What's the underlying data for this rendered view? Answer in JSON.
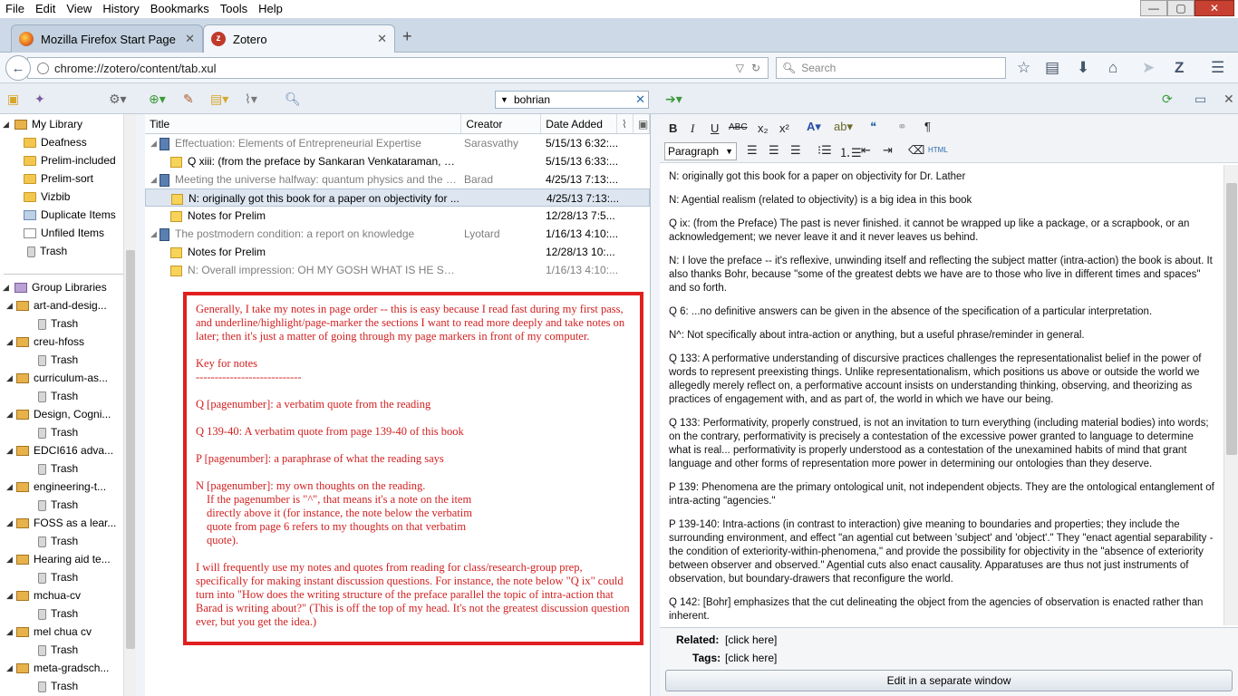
{
  "menubar": {
    "items": [
      "File",
      "Edit",
      "View",
      "History",
      "Bookmarks",
      "Tools",
      "Help"
    ]
  },
  "window": {
    "minimize": "—",
    "maximize": "▢",
    "close": "✕"
  },
  "tabs": [
    {
      "label": "Mozilla Firefox Start Page",
      "close": "✕"
    },
    {
      "label": "Zotero",
      "close": "✕"
    }
  ],
  "new_tab": "+",
  "navbar": {
    "url": "chrome://zotero/content/tab.xul",
    "search_placeholder": "Search"
  },
  "zotero_search": {
    "value": "bohrian"
  },
  "collections": {
    "my_library": "My Library",
    "my_items": [
      "Deafness",
      "Prelim-included",
      "Prelim-sort",
      "Vizbib",
      "Duplicate Items",
      "Unfiled Items",
      "Trash"
    ],
    "group_libraries": "Group Libraries",
    "groups": [
      {
        "name": "art-and-desig...",
        "trash": "Trash"
      },
      {
        "name": "creu-hfoss",
        "trash": "Trash"
      },
      {
        "name": "curriculum-as...",
        "trash": "Trash"
      },
      {
        "name": "Design, Cogni...",
        "trash": "Trash"
      },
      {
        "name": "EDCI616 adva...",
        "trash": "Trash"
      },
      {
        "name": "engineering-t...",
        "trash": "Trash"
      },
      {
        "name": "FOSS as a lear...",
        "trash": "Trash"
      },
      {
        "name": "Hearing aid te...",
        "trash": "Trash"
      },
      {
        "name": "mchua-cv",
        "trash": "Trash"
      },
      {
        "name": "mel chua cv",
        "trash": "Trash"
      },
      {
        "name": "meta-gradsch...",
        "trash": "Trash"
      }
    ]
  },
  "items": {
    "headers": {
      "title": "Title",
      "creator": "Creator",
      "date": "Date Added"
    },
    "rows": [
      {
        "title": "Effectuation: Elements of Entrepreneurial Expertise",
        "creator": "Sarasvathy",
        "date": "5/15/13 6:32:..."
      },
      {
        "title": "Q xiii: (from the preface by Sankaran Venkataraman, For...",
        "creator": "",
        "date": "5/15/13 6:33:..."
      },
      {
        "title": "Meeting the universe halfway: quantum physics and the e...",
        "creator": "Barad",
        "date": "4/25/13 7:13:..."
      },
      {
        "title": "N: originally got this book for a paper on objectivity for ...",
        "creator": "",
        "date": "4/25/13 7:13:..."
      },
      {
        "title": "Notes for Prelim",
        "creator": "",
        "date": "12/28/13 7:5..."
      },
      {
        "title": "The postmodern condition: a report on knowledge",
        "creator": "Lyotard",
        "date": "1/16/13 4:10:..."
      },
      {
        "title": "Notes for Prelim",
        "creator": "",
        "date": "12/28/13 10:..."
      },
      {
        "title": "N: Overall impression: OH MY GOSH WHAT IS HE SAYI...",
        "creator": "",
        "date": "1/16/13 4:10:..."
      }
    ]
  },
  "annotation": {
    "p1": "Generally, I take my notes in page order -- this is easy because I read fast during my first pass, and underline/highlight/page-marker the sections I want to read more deeply and take notes on later; then it's just a matter of going through my page markers in front of my computer.",
    "key_title": "Key for notes",
    "key_rule": "----------------------------",
    "k1": "Q [pagenumber]: a verbatim quote from the reading",
    "k2": "Q 139-40: A verbatim quote from page 139-40 of this book",
    "k3": "P [pagenumber]: a paraphrase of what the reading says",
    "k4": "N [pagenumber]: my own thoughts on the reading.",
    "k4b": "If the pagenumber is \"^\", that means it's a note on the item directly above it (for instance, the note below the verbatim quote from page 6 refers to my thoughts on that verbatim quote).",
    "p_last": "I will frequently use my notes and quotes from reading for class/research-group prep, specifically for making instant discussion questions. For instance, the note below \"Q ix\" could turn into \"How does the writing structure of the preface parallel the topic of intra-action that Barad is writing about?\" (This is off the top of my head. It's not the greatest discussion question ever, but you get the idea.)"
  },
  "editor": {
    "paragraph": "Paragraph",
    "notes": [
      "N: originally got this book for a paper on objectivity for Dr. Lather",
      "N: Agential realism (related to objectivity) is a big idea in this book",
      "Q ix: (from the Preface) The past is never finished. it cannot be wrapped up like a package, or a scrapbook, or an acknowledgement; we never leave it and it never leaves us behind.",
      "N: I love the preface -- it's reflexive, unwinding itself and reflecting the subject matter (intra-action) the book is about. It also thanks Bohr, because \"some of the greatest debts we have are to those who live in different times and spaces\" and so forth.",
      "Q 6: ...no definitive answers can be given in the absence of the specification of a particular interpretation.",
      "N^: Not specifically about intra-action or anything, but a useful phrase/reminder in general.",
      "Q 133: A performative understanding of discursive practices challenges the representationalist belief in the power of words to represent preexisting things. Unlike representationalism, which positions us above or outside the world we allegedly merely reflect on, a performative account insists on understanding thinking, observing, and theorizing as practices of engagement with, and as part of, the world in which we have our being.",
      "Q 133: Performativity, properly construed, is not an invitation to turn everything (including material bodies) into words; on the contrary, performativity is precisely a contestation of the excessive power granted to language to determine what is real... performativity is properly understood as a contestation of the unexamined habits of mind that grant language and other forms of representation more power in determining our ontologies than they deserve.",
      "P 139: Phenomena are the primary ontological unit, not independent objects. They are the ontological entanglement of intra-acting \"agencies.\"",
      "P 139-140: Intra-actions (in contrast to interaction) give meaning to boundaries and properties; they include the surrounding environment, and effect \"an agential cut between 'subject' and 'object'.\" They \"enact agential separability - the condition of exteriority-within-phenomena,\" and provide the possibility for objectivity in the \"absence of exteriority between observer and observed.\" Agential cuts also enact causality. Apparatuses are thus not just instruments of observation, but boundary-drawers that reconfigure the world.",
      "Q 142: [Bohr] emphasizes that the cut delineating the object from the agencies of observation is enacted rather than inherent."
    ],
    "related_label": "Related:",
    "related_value": "[click here]",
    "tags_label": "Tags:",
    "tags_value": "[click here]",
    "edit_window": "Edit in a separate window"
  },
  "colors": {
    "accent_red": "#e01f1f",
    "annotation_text": "#d22020",
    "selection": "#dde6f0"
  },
  "icons": [
    "firefox-icon",
    "zotero-icon",
    "back-icon",
    "bookmark-star-icon",
    "reading-list-icon",
    "download-icon",
    "home-icon",
    "send-icon",
    "zotero-z-icon",
    "hamburger-menu-icon",
    "new-collection-icon",
    "new-group-icon",
    "actions-gear-icon",
    "new-item-icon",
    "add-by-identifier-icon",
    "new-note-icon",
    "attach-icon",
    "locate-icon",
    "search-icon",
    "clear-search-icon",
    "forward-arrow-icon",
    "sync-icon",
    "fullscreen-icon",
    "close-zotero-icon"
  ]
}
